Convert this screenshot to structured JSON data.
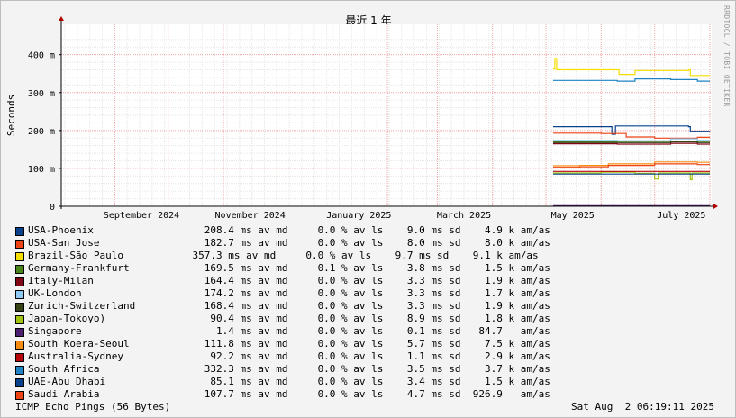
{
  "chart_data": {
    "type": "line",
    "title": "最近 1 年",
    "ylabel": "Seconds",
    "xlabel": "",
    "ylim": [
      0,
      480
    ],
    "y_ticks": [
      {
        "value": 0,
        "label": "0"
      },
      {
        "value": 100,
        "label": "100 m"
      },
      {
        "value": 200,
        "label": "200 m"
      },
      {
        "value": 300,
        "label": "300 m"
      },
      {
        "value": 400,
        "label": "400 m"
      }
    ],
    "x_ticks": [
      "September 2024",
      "November 2024",
      "January 2025",
      "March 2025",
      "May 2025",
      "July 2025"
    ],
    "grid": true,
    "series": [
      {
        "name": "USA-Phoenix",
        "color": "#08418c",
        "values": [
          {
            "x": "2025-05-05",
            "y": 210
          },
          {
            "x": "2025-06-05",
            "y": 210
          },
          {
            "x": "2025-06-07",
            "y": 190
          },
          {
            "x": "2025-06-09",
            "y": 212
          },
          {
            "x": "2025-07-20",
            "y": 210
          },
          {
            "x": "2025-07-21",
            "y": 198
          }
        ]
      },
      {
        "name": "USA-San Jose",
        "color": "#ed4315",
        "values": [
          {
            "x": "2025-05-05",
            "y": 193
          },
          {
            "x": "2025-06-01",
            "y": 192
          },
          {
            "x": "2025-06-15",
            "y": 183
          },
          {
            "x": "2025-07-01",
            "y": 180
          },
          {
            "x": "2025-07-25",
            "y": 182
          }
        ]
      },
      {
        "name": "Brazil-São Paulo",
        "color": "#f5de00",
        "values": [
          {
            "x": "2025-05-05",
            "y": 362
          },
          {
            "x": "2025-05-06",
            "y": 390
          },
          {
            "x": "2025-05-07",
            "y": 360
          },
          {
            "x": "2025-06-10",
            "y": 360
          },
          {
            "x": "2025-06-11",
            "y": 348
          },
          {
            "x": "2025-06-20",
            "y": 358
          },
          {
            "x": "2025-07-20",
            "y": 360
          },
          {
            "x": "2025-07-21",
            "y": 345
          }
        ]
      },
      {
        "name": "Germany-Frankfurt",
        "color": "#48861c",
        "values": [
          {
            "x": "2025-05-05",
            "y": 170
          },
          {
            "x": "2025-06-10",
            "y": 169
          },
          {
            "x": "2025-07-10",
            "y": 172
          },
          {
            "x": "2025-07-25",
            "y": 169
          }
        ]
      },
      {
        "name": "Italy-Milan",
        "color": "#800515",
        "values": [
          {
            "x": "2025-05-05",
            "y": 165
          },
          {
            "x": "2025-06-10",
            "y": 164
          },
          {
            "x": "2025-07-10",
            "y": 166
          },
          {
            "x": "2025-07-25",
            "y": 164
          }
        ]
      },
      {
        "name": "UK-London",
        "color": "#8ec9f4",
        "values": [
          {
            "x": "2025-05-05",
            "y": 174
          },
          {
            "x": "2025-06-10",
            "y": 173
          },
          {
            "x": "2025-07-10",
            "y": 178
          },
          {
            "x": "2025-07-25",
            "y": 174
          }
        ]
      },
      {
        "name": "Zurich-Switzerland",
        "color": "#364315",
        "values": [
          {
            "x": "2025-05-05",
            "y": 168
          },
          {
            "x": "2025-06-10",
            "y": 168
          },
          {
            "x": "2025-07-10",
            "y": 170
          },
          {
            "x": "2025-07-25",
            "y": 168
          }
        ]
      },
      {
        "name": "Japan-Tokoyo)",
        "color": "#a1c311",
        "values": [
          {
            "x": "2025-05-05",
            "y": 88
          },
          {
            "x": "2025-06-01",
            "y": 90
          },
          {
            "x": "2025-06-20",
            "y": 87
          },
          {
            "x": "2025-07-01",
            "y": 72
          },
          {
            "x": "2025-07-03",
            "y": 88
          },
          {
            "x": "2025-07-20",
            "y": 88
          },
          {
            "x": "2025-07-21",
            "y": 70
          },
          {
            "x": "2025-07-22",
            "y": 88
          }
        ]
      },
      {
        "name": "Singapore",
        "color": "#4d1f71",
        "values": [
          {
            "x": "2025-05-05",
            "y": 1.4
          },
          {
            "x": "2025-07-25",
            "y": 1.4
          }
        ]
      },
      {
        "name": "South Koera-Seoul",
        "color": "#f78c13",
        "values": [
          {
            "x": "2025-05-05",
            "y": 107
          },
          {
            "x": "2025-05-20",
            "y": 108
          },
          {
            "x": "2025-06-05",
            "y": 112
          },
          {
            "x": "2025-07-01",
            "y": 117
          },
          {
            "x": "2025-07-25",
            "y": 116
          }
        ]
      },
      {
        "name": "Australia-Sydney",
        "color": "#b8050b",
        "values": [
          {
            "x": "2025-05-05",
            "y": 92
          },
          {
            "x": "2025-07-25",
            "y": 92
          }
        ]
      },
      {
        "name": "South Africa",
        "color": "#1e82c4",
        "values": [
          {
            "x": "2025-05-05",
            "y": 332
          },
          {
            "x": "2025-06-10",
            "y": 330
          },
          {
            "x": "2025-06-20",
            "y": 336
          },
          {
            "x": "2025-07-10",
            "y": 334
          },
          {
            "x": "2025-07-25",
            "y": 330
          }
        ]
      },
      {
        "name": "UAE-Abu Dhabi",
        "color": "#08418c",
        "values": [
          {
            "x": "2025-05-05",
            "y": 85
          },
          {
            "x": "2025-07-25",
            "y": 85
          }
        ]
      },
      {
        "name": "Saudi Arabia",
        "color": "#ed4315",
        "values": [
          {
            "x": "2025-05-05",
            "y": 103
          },
          {
            "x": "2025-05-20",
            "y": 104
          },
          {
            "x": "2025-06-05",
            "y": 108
          },
          {
            "x": "2025-07-01",
            "y": 112
          },
          {
            "x": "2025-07-25",
            "y": 110
          }
        ]
      }
    ]
  },
  "legend": [
    {
      "name": "USA-Phoenix",
      "stats": "      208.4 ms av md     0.0 % av ls    9.0 ms sd    4.9 k am/as",
      "color": "#08418c"
    },
    {
      "name": "USA-San Jose",
      "stats": "      182.7 ms av md     0.0 % av ls    8.0 ms sd    8.0 k am/as",
      "color": "#ed4315"
    },
    {
      "name": "Brazil-São Paulo",
      "stats": "    357.3 ms av md     0.0 % av ls    9.7 ms sd    9.1 k am/as",
      "color": "#f5de00"
    },
    {
      "name": "Germany-Frankfurt",
      "stats": "      169.5 ms av md     0.1 % av ls    3.8 ms sd    1.5 k am/as",
      "color": "#48861c"
    },
    {
      "name": "Italy-Milan",
      "stats": "      164.4 ms av md     0.0 % av ls    3.3 ms sd    1.9 k am/as",
      "color": "#800515"
    },
    {
      "name": "UK-London",
      "stats": "      174.2 ms av md     0.0 % av ls    3.3 ms sd    1.7 k am/as",
      "color": "#8ec9f4"
    },
    {
      "name": "Zurich-Switzerland",
      "stats": "      168.4 ms av md     0.0 % av ls    3.3 ms sd    1.9 k am/as",
      "color": "#364315"
    },
    {
      "name": "Japan-Tokoyo)",
      "stats": "       90.4 ms av md     0.0 % av ls    8.9 ms sd    1.8 k am/as",
      "color": "#a1c311"
    },
    {
      "name": "Singapore",
      "stats": "        1.4 ms av md     0.0 % av ls    0.1 ms sd   84.7   am/as",
      "color": "#4d1f71"
    },
    {
      "name": "South Koera-Seoul",
      "stats": "      111.8 ms av md     0.0 % av ls    5.7 ms sd    7.5 k am/as",
      "color": "#f78c13"
    },
    {
      "name": "Australia-Sydney",
      "stats": "       92.2 ms av md     0.0 % av ls    1.1 ms sd    2.9 k am/as",
      "color": "#b8050b"
    },
    {
      "name": "South Africa",
      "stats": "      332.3 ms av md     0.0 % av ls    3.5 ms sd    3.7 k am/as",
      "color": "#1e82c4"
    },
    {
      "name": "UAE-Abu Dhabi",
      "stats": "       85.1 ms av md     0.0 % av ls    3.4 ms sd    1.5 k am/as",
      "color": "#08418c"
    },
    {
      "name": "Saudi Arabia",
      "stats": "      107.7 ms av md     0.0 % av ls    4.7 ms sd  926.9   am/as",
      "color": "#ed4315"
    }
  ],
  "footer": {
    "left": "ICMP Echo Pings (56 Bytes)",
    "right": "Sat Aug  2 06:19:11 2025"
  },
  "watermark": "RRDTOOL / TOBI OETIKER"
}
